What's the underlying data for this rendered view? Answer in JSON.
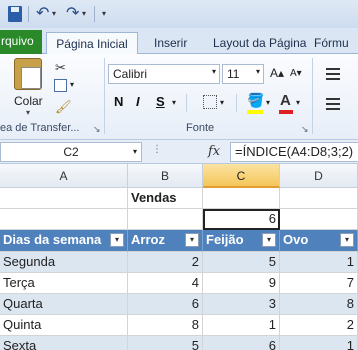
{
  "qat": {
    "undo": "↶",
    "redo": "↷",
    "dropdown": "▾",
    "customize": "▾"
  },
  "tabs": {
    "file": "rquivo",
    "home": "Página Inicial",
    "insert": "Inserir",
    "layout": "Layout da Página",
    "formulas": "Fórmu"
  },
  "ribbon": {
    "clipboard": {
      "paste_label": "Colar",
      "group_label": "ea de Transfer...",
      "cut_icon": "✂",
      "brush_icon": "🖌"
    },
    "font": {
      "font_name": "Calibri",
      "font_size": "11",
      "grow": "A▴",
      "shrink": "A▾",
      "bold": "N",
      "italic": "I",
      "underline": "S",
      "fill_icon": "🪣",
      "font_color_letter": "A",
      "group_label": "Fonte"
    },
    "launcher": "↘",
    "colors": {
      "fill_yellow": "#ffff00",
      "font_red": "#e02020"
    }
  },
  "formula_bar": {
    "name_box": "C2",
    "fx": "fx",
    "dots": "⋮",
    "formula": "=ÍNDICE(A4:D8;3;2)"
  },
  "grid": {
    "columns": [
      "A",
      "B",
      "C",
      "D"
    ],
    "selected_column": "C",
    "title": "Vendas",
    "result": "6",
    "headers": [
      "Dias da semana",
      "Arroz",
      "Feijão",
      "Ovo"
    ],
    "rows": [
      [
        "Segunda",
        "2",
        "5",
        "1"
      ],
      [
        "Terça",
        "4",
        "9",
        "7"
      ],
      [
        "Quarta",
        "6",
        "3",
        "8"
      ],
      [
        "Quinta",
        "8",
        "1",
        "2"
      ],
      [
        "Sexta",
        "5",
        "6",
        "1"
      ]
    ],
    "filter_icon": "▾",
    "colors": {
      "header_blue": "#4f81bd",
      "band_light": "#dce6f1",
      "selected_header": "#f5c659"
    }
  }
}
